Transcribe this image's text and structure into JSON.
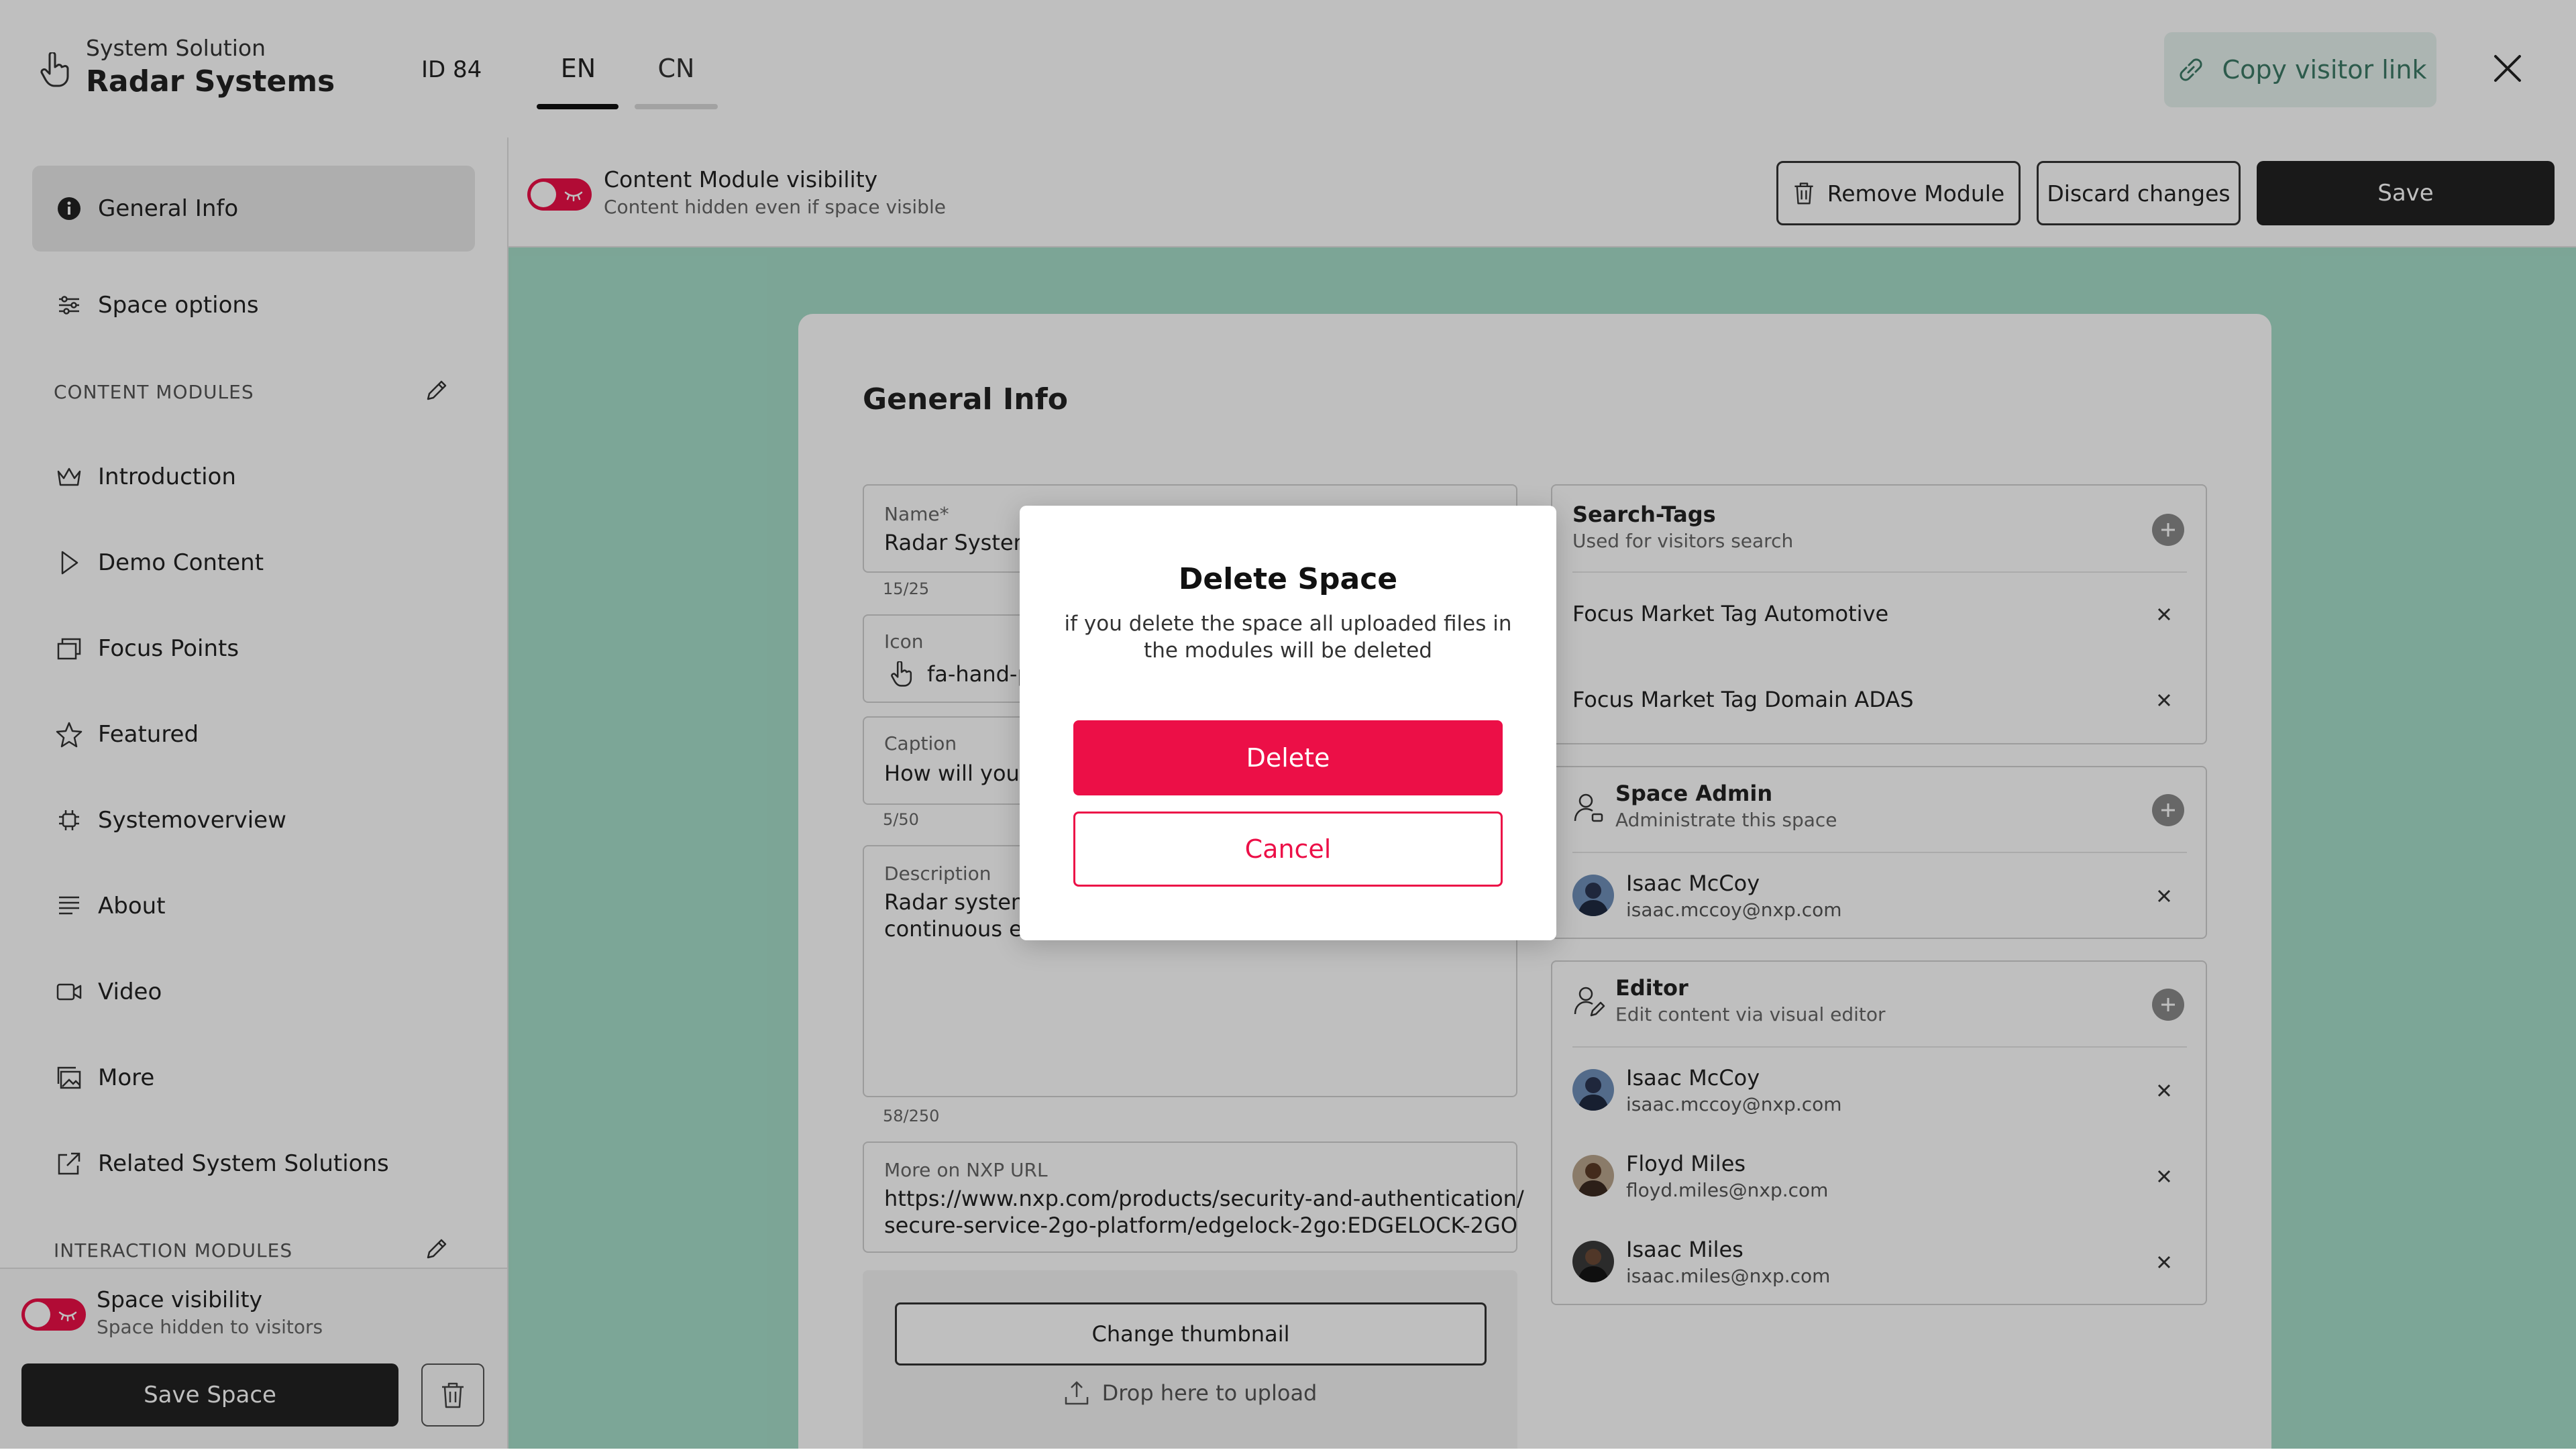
{
  "header": {
    "supertitle": "System Solution",
    "title": "Radar Systems",
    "id_label": "ID 84",
    "tabs": [
      {
        "label": "EN",
        "active": true
      },
      {
        "label": "CN",
        "active": false
      }
    ],
    "copy_link_label": "Copy visitor link"
  },
  "sidebar": {
    "general_info": "General Info",
    "space_options": "Space options",
    "content_modules_label": "CONTENT MODULES",
    "items": [
      {
        "label": "Introduction",
        "icon": "crown-icon"
      },
      {
        "label": "Demo Content",
        "icon": "play-icon"
      },
      {
        "label": "Focus Points",
        "icon": "layers-icon"
      },
      {
        "label": "Featured",
        "icon": "star-icon"
      },
      {
        "label": "Systemoverview",
        "icon": "chip-icon"
      },
      {
        "label": "About",
        "icon": "lines-icon"
      },
      {
        "label": "Video",
        "icon": "video-icon"
      },
      {
        "label": "More",
        "icon": "gallery-icon"
      },
      {
        "label": "Related System Solutions",
        "icon": "external-link-icon"
      }
    ],
    "interaction_modules_label": "INTERACTION MODULES",
    "visibility_title": "Space visibility",
    "visibility_sub": "Space hidden to visitors",
    "save_space_label": "Save Space"
  },
  "toolbar": {
    "module_visibility_title": "Content Module visibility",
    "module_visibility_sub": "Content hidden even if space visible",
    "remove_module_label": "Remove Module",
    "discard_label": "Discard changes",
    "save_label": "Save"
  },
  "form": {
    "title": "General Info",
    "name_label": "Name*",
    "name_value": "Radar System",
    "name_counter": "15/25",
    "icon_label": "Icon",
    "icon_value": "fa-hand-p",
    "caption_label": "Caption",
    "caption_value": "How will you",
    "caption_counter": "5/50",
    "description_label": "Description",
    "description_line1": "Radar system",
    "description_line2": "continuous en",
    "description_counter": "58/250",
    "url_label": "More on NXP URL",
    "url_line1": "https://www.nxp.com/products/security-and-authentication/",
    "url_line2": "secure-service-2go-platform/edgelock-2go:EDGELOCK-2GO",
    "change_thumbnail_label": "Change thumbnail",
    "drop_label": "Drop here to upload"
  },
  "search_tags": {
    "title": "Search-Tags",
    "subtitle": "Used for visitors search",
    "tags": [
      "Focus Market Tag Automotive",
      "Focus Market Tag  Domain ADAS"
    ]
  },
  "space_admin": {
    "title": "Space Admin",
    "subtitle": "Administrate this space",
    "people": [
      {
        "name": "Isaac McCoy",
        "email": "isaac.mccoy@nxp.com"
      }
    ]
  },
  "editor": {
    "title": "Editor",
    "subtitle": "Edit content via visual editor",
    "people": [
      {
        "name": "Isaac McCoy",
        "email": "isaac.mccoy@nxp.com"
      },
      {
        "name": "Floyd Miles",
        "email": "floyd.miles@nxp.com"
      },
      {
        "name": "Isaac Miles",
        "email": "isaac.miles@nxp.com"
      }
    ]
  },
  "modal": {
    "title": "Delete Space",
    "message": "if you delete the space all uploaded files in the modules will be deleted",
    "delete_label": "Delete",
    "cancel_label": "Cancel"
  },
  "colors": {
    "accent_red": "#ec0f47",
    "content_green": "#a6ddc9",
    "copy_link_green": "#3c7a66"
  }
}
